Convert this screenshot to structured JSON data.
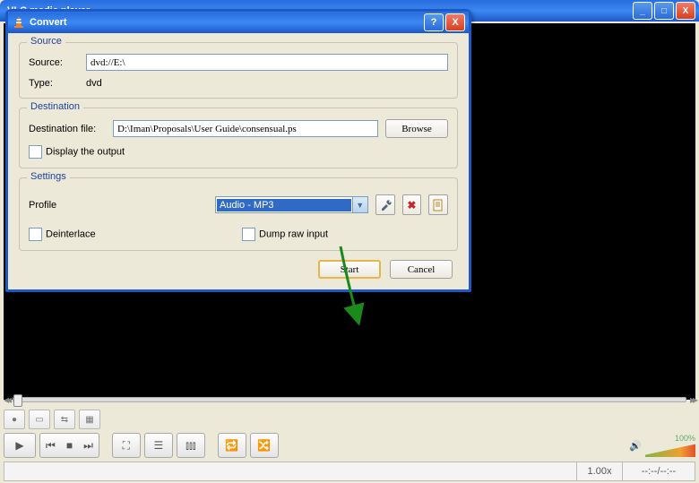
{
  "outer_window": {
    "title": "VLC media player",
    "min_tip": "_",
    "max_tip": "□",
    "close_tip": "X"
  },
  "dialog": {
    "title": "Convert",
    "help": "?",
    "close": "X",
    "source": {
      "legend": "Source",
      "source_label": "Source:",
      "source_value": "dvd://E:\\",
      "type_label": "Type:",
      "type_value": "dvd"
    },
    "destination": {
      "legend": "Destination",
      "file_label": "Destination file:",
      "file_value": "D:\\Iman\\Proposals\\User Guide\\consensual.ps",
      "browse": "Browse",
      "display_output": "Display the output",
      "display_output_checked": false
    },
    "settings": {
      "legend": "Settings",
      "profile_label": "Profile",
      "profile_value": "Audio - MP3",
      "tool_tip": "Edit selected profile",
      "delete_tip": "Delete selected profile",
      "new_tip": "Create a new profile",
      "deinterlace": "Deinterlace",
      "deinterlace_checked": false,
      "dump_raw": "Dump raw input",
      "dump_raw_checked": false
    },
    "buttons": {
      "start": "Start",
      "cancel": "Cancel"
    }
  },
  "player": {
    "seek_prev": "◂◂",
    "seek_next": "▸▸",
    "volume_label": "100%",
    "speed": "1.00x",
    "time": "--:--/--:--"
  }
}
